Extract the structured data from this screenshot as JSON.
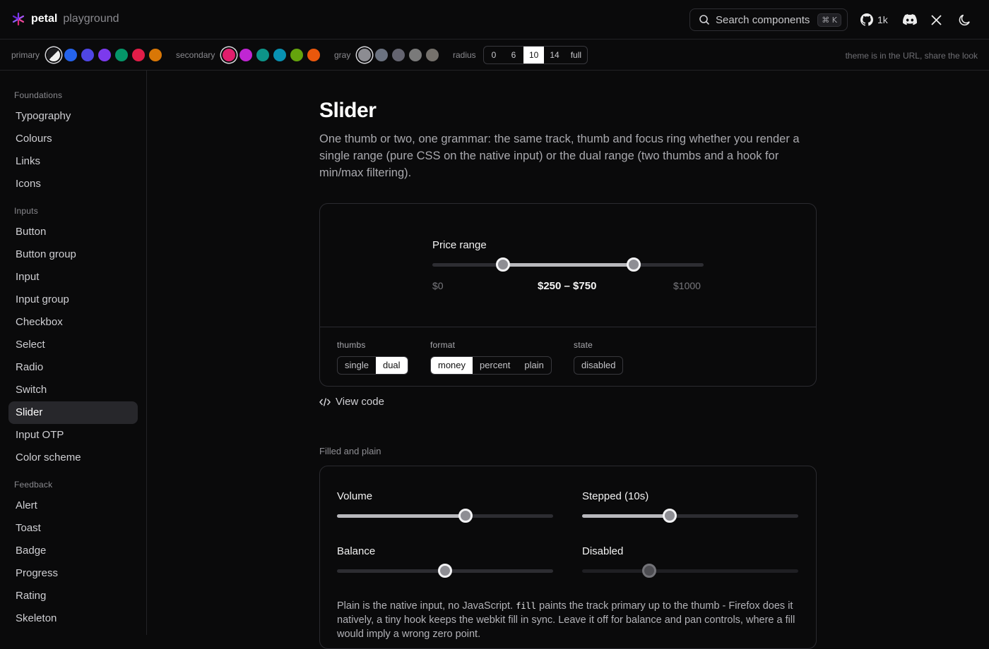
{
  "brand": {
    "name": "petal",
    "sub": "playground"
  },
  "search": {
    "placeholder": "Search components",
    "shortcut": "⌘ K"
  },
  "header": {
    "github_count": "1k",
    "icons": [
      "github-icon",
      "discord-icon",
      "x-icon",
      "moon-icon"
    ]
  },
  "theme": {
    "primary_label": "primary",
    "primary_colors": [
      "#e8e8e8",
      "#2563eb",
      "#4f46e5",
      "#7c3aed",
      "#059669",
      "#e11d48",
      "#d97706"
    ],
    "secondary_label": "secondary",
    "secondary_colors": [
      "#e11d6c",
      "#c026d3",
      "#0d9488",
      "#0891b2",
      "#65a30d",
      "#ea580c"
    ],
    "gray_label": "gray",
    "gray_colors": [
      "#8c8c92",
      "#6b7280",
      "#646470",
      "#7a7a7a",
      "#75716c"
    ],
    "radius_label": "radius",
    "radius_options": [
      "0",
      "6",
      "10",
      "14",
      "full"
    ],
    "radius_selected": "10",
    "note": "theme is in the URL, share the look"
  },
  "sidebar": {
    "groups": [
      {
        "title": "Foundations",
        "items": [
          "Typography",
          "Colours",
          "Links",
          "Icons"
        ]
      },
      {
        "title": "Inputs",
        "items": [
          "Button",
          "Button group",
          "Input",
          "Input group",
          "Checkbox",
          "Select",
          "Radio",
          "Switch",
          "Slider",
          "Input OTP",
          "Color scheme"
        ]
      },
      {
        "title": "Feedback",
        "items": [
          "Alert",
          "Toast",
          "Badge",
          "Progress",
          "Rating",
          "Skeleton"
        ]
      }
    ],
    "active": "Slider"
  },
  "page": {
    "title": "Slider",
    "lead": "One thumb or two, one grammar: the same track, thumb and focus ring whether you render a single range (pure CSS on the native input) or the dual range (two thumbs and a hook for min/max filtering)."
  },
  "demo": {
    "label": "Price range",
    "min_label": "$0",
    "max_label": "$1000",
    "range_text": "$250 – $750",
    "low": 0.25,
    "high": 0.75,
    "thumbs_label": "thumbs",
    "thumbs_options": [
      "single",
      "dual"
    ],
    "thumbs_selected": "dual",
    "format_label": "format",
    "format_options": [
      "money",
      "percent",
      "plain"
    ],
    "format_selected": "money",
    "state_label": "state",
    "state_options": [
      "disabled"
    ]
  },
  "view_code": "View code",
  "section2": {
    "heading": "Filled and plain",
    "sliders": [
      {
        "label": "Volume",
        "value": 0.6,
        "filled": true,
        "disabled": false
      },
      {
        "label": "Stepped (10s)",
        "value": 0.4,
        "filled": true,
        "disabled": false
      },
      {
        "label": "Balance",
        "value": 0.5,
        "filled": false,
        "disabled": false
      },
      {
        "label": "Disabled",
        "value": 0.3,
        "filled": false,
        "disabled": true
      }
    ],
    "note_before": "Plain is the native input, no JavaScript. ",
    "note_code": "fill",
    "note_after": " paints the track primary up to the thumb - Firefox does it natively, a tiny hook keeps the webkit fill in sync. Leave it off for balance and pan controls, where a fill would imply a wrong zero point."
  }
}
